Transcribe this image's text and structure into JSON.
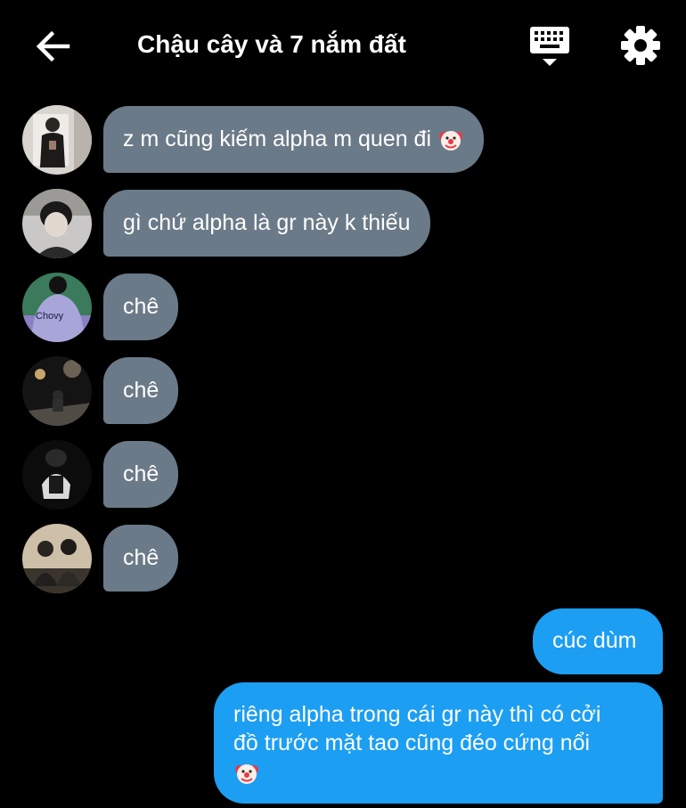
{
  "header": {
    "title": "Chậu cây và 7 nắm đất",
    "back_icon": "arrow-left-icon",
    "keyboard_icon": "keyboard-icon",
    "settings_icon": "gear-icon"
  },
  "colors": {
    "background": "#000000",
    "incoming_bubble": "#6b7a88",
    "outgoing_bubble": "#1c9ef3",
    "text": "#ffffff"
  },
  "messages": [
    {
      "direction": "incoming",
      "avatar": "avatar-1",
      "text": "z m cũng kiếm alpha m quen đi",
      "emoji": "clown-face-emoji"
    },
    {
      "direction": "incoming",
      "avatar": "avatar-2",
      "text": "gì chứ alpha là gr này k thiếu"
    },
    {
      "direction": "incoming",
      "avatar": "avatar-3",
      "text": "chê",
      "avatar_caption": "Chovy"
    },
    {
      "direction": "incoming",
      "avatar": "avatar-4",
      "text": "chê"
    },
    {
      "direction": "incoming",
      "avatar": "avatar-5",
      "text": "chê"
    },
    {
      "direction": "incoming",
      "avatar": "avatar-6",
      "text": "chê"
    },
    {
      "direction": "outgoing",
      "text": "cúc dùm"
    },
    {
      "direction": "outgoing",
      "lines": [
        "riêng alpha trong cái gr này thì có cởi",
        "đồ trước mặt tao cũng đéo cứng nổi"
      ],
      "emoji": "clown-face-emoji"
    }
  ]
}
